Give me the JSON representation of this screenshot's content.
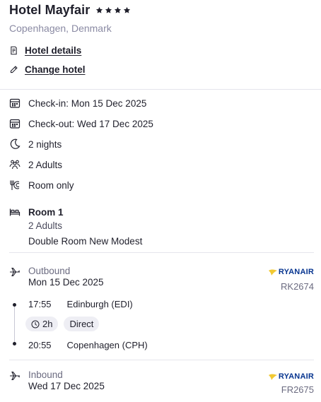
{
  "hotel": {
    "name": "Hotel Mayfair",
    "stars": 4,
    "location": "Copenhagen, Denmark"
  },
  "links": {
    "details": "Hotel details",
    "change": "Change hotel"
  },
  "stay": {
    "checkin": "Check-in: Mon 15 Dec 2025",
    "checkout": "Check-out: Wed 17 Dec 2025",
    "nights": "2 nights",
    "guests": "2 Adults",
    "board": "Room only"
  },
  "room": {
    "title": "Room 1",
    "guests": "2 Adults",
    "type": "Double Room New Modest"
  },
  "outbound": {
    "kind": "Outbound",
    "date": "Mon 15 Dec 2025",
    "airline": "RYANAIR",
    "flight_code": "RK2674",
    "depart_time": "17:55",
    "depart_airport": "Edinburgh (EDI)",
    "duration": "2h",
    "stops": "Direct",
    "arrive_time": "20:55",
    "arrive_airport": "Copenhagen (CPH)"
  },
  "inbound": {
    "kind": "Inbound",
    "date": "Wed 17 Dec 2025",
    "airline": "RYANAIR",
    "flight_code": "FR2675"
  },
  "colors": {
    "text": "#1f1f2b",
    "muted": "#8a8aa3",
    "ryanair_blue": "#073590",
    "ryanair_yellow": "#f1c933",
    "chip_bg": "#eeeef4"
  },
  "icons": {
    "details": "document-icon",
    "change": "pencil-icon",
    "calendar": "calendar-icon",
    "nights": "moon-icon",
    "guests": "people-icon",
    "board": "cutlery-icon",
    "room": "bed-icon",
    "outbound": "plane-departure-icon",
    "inbound": "plane-arrival-icon",
    "duration": "clock-icon"
  }
}
